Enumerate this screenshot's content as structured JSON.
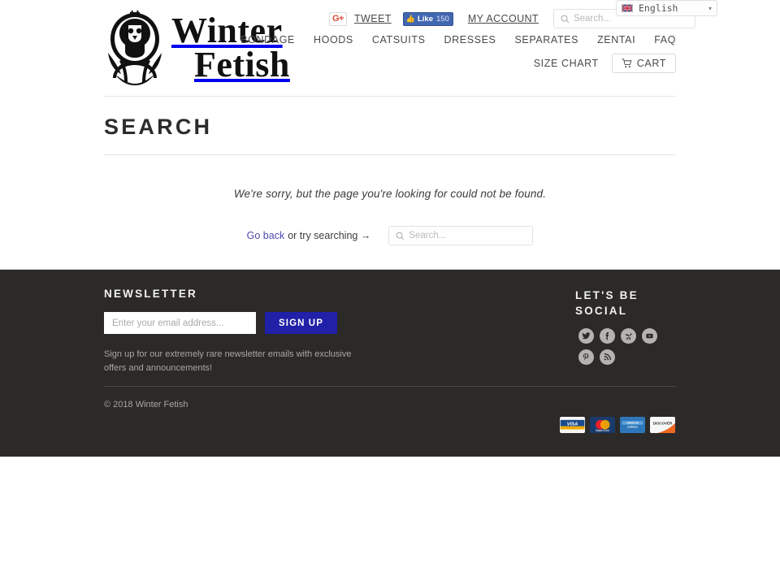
{
  "brand": {
    "name_line1": "Winter",
    "name_line2": "Fetish",
    "emblem_alt": "winter-fetish-crest-emblem"
  },
  "header": {
    "social": {
      "gplus_label": "G+",
      "tweet_label": "TWEET",
      "fb_like_label": "Like",
      "fb_like_count": "150"
    },
    "account_label": "MY ACCOUNT",
    "search_placeholder": "Search...",
    "search_value": "",
    "language": {
      "selected": "English",
      "caret": "▾",
      "flag": "uk-flag-icon"
    },
    "nav_primary": [
      {
        "label": "BONDAGE"
      },
      {
        "label": "HOODS"
      },
      {
        "label": "CATSUITS"
      },
      {
        "label": "DRESSES"
      },
      {
        "label": "SEPARATES"
      },
      {
        "label": "ZENTAI"
      },
      {
        "label": "FAQ"
      }
    ],
    "nav_secondary": {
      "size_chart_label": "SIZE CHART",
      "cart_label": "CART"
    }
  },
  "main": {
    "page_title": "SEARCH",
    "not_found_message": "We're sorry, but the page you're looking for could not be found.",
    "go_back_label": "Go back",
    "or_try_label": "or try searching →",
    "search_placeholder": "Search...",
    "search_value": ""
  },
  "footer": {
    "newsletter": {
      "title": "NEWSLETTER",
      "email_placeholder": "Enter your email address...",
      "email_value": "",
      "signup_label": "SIGN UP",
      "description": "Sign up for our extremely rare newsletter emails with exclusive offers and announcements!"
    },
    "social": {
      "title": "LET'S BE SOCIAL",
      "icons": [
        {
          "name": "twitter-icon"
        },
        {
          "name": "facebook-icon"
        },
        {
          "name": "yelp-icon"
        },
        {
          "name": "youtube-icon"
        },
        {
          "name": "pinterest-icon"
        },
        {
          "name": "rss-icon"
        }
      ]
    },
    "copyright": "© 2018 Winter Fetish",
    "payments": [
      {
        "name": "visa-card-icon",
        "label": "VISA"
      },
      {
        "name": "mastercard-card-icon",
        "label": "MasterCard"
      },
      {
        "name": "amex-card-icon",
        "label": "AMERICAN EXPRESS"
      },
      {
        "name": "discover-card-icon",
        "label": "DISCOVER"
      }
    ]
  },
  "colors": {
    "footer_bg": "#2b2a28",
    "signup_btn": "#2020a8",
    "link": "#4a4ab0",
    "text": "#4a4a4a",
    "gplus_red": "#dd4b39",
    "fb_blue": "#4267b2"
  }
}
